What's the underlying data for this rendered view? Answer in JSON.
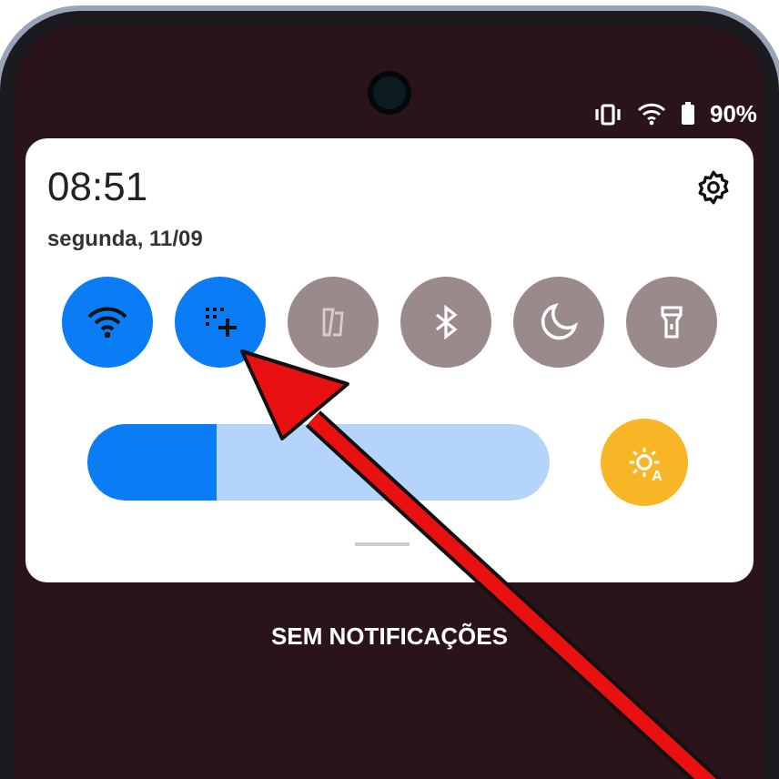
{
  "status_bar": {
    "battery": "90%"
  },
  "panel": {
    "time": "08:51",
    "date": "segunda, 11/09"
  },
  "toggles": [
    {
      "kind": "wifi",
      "on": true
    },
    {
      "kind": "add",
      "on": true
    },
    {
      "kind": "rotate",
      "on": false
    },
    {
      "kind": "bluetooth",
      "on": false
    },
    {
      "kind": "moon",
      "on": false
    },
    {
      "kind": "flashlight",
      "on": false
    }
  ],
  "brightness": {
    "level": 0.28,
    "auto": true,
    "auto_label": "A"
  },
  "notifications": {
    "message": "SEM NOTIFICAÇÕES"
  }
}
